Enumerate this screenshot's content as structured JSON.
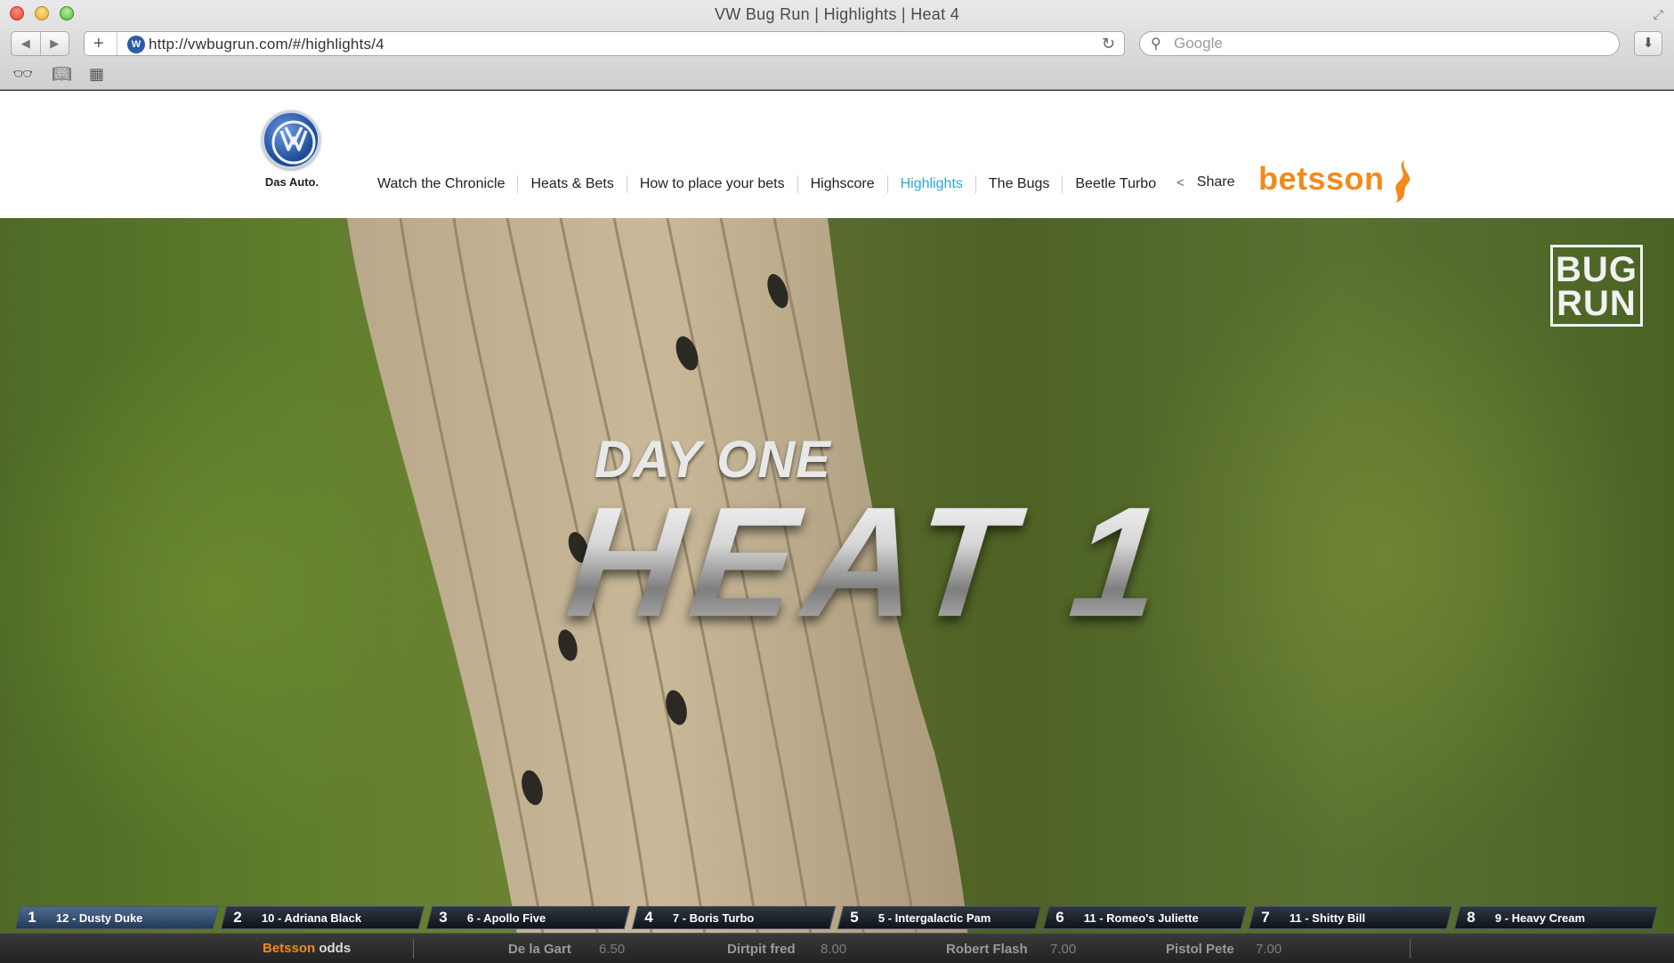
{
  "browser": {
    "window_title": "VW Bug Run | Highlights | Heat 4",
    "url": "http://vwbugrun.com/#/highlights/4",
    "search_placeholder": "Google",
    "url_badge": "W"
  },
  "site": {
    "brand_tagline": "Das Auto.",
    "nav": [
      {
        "label": "Watch the Chronicle",
        "active": false
      },
      {
        "label": "Heats & Bets",
        "active": false
      },
      {
        "label": "How to place your bets",
        "active": false
      },
      {
        "label": "Highscore",
        "active": false
      },
      {
        "label": "Highlights",
        "active": true
      },
      {
        "label": "The Bugs",
        "active": false
      },
      {
        "label": "Beetle Turbo",
        "active": false
      }
    ],
    "share_label": "Share",
    "sponsor": "betsson",
    "accent_color": "#2aa6e0",
    "sponsor_color": "#f28a1c"
  },
  "video": {
    "logo_top": "BUG",
    "logo_bottom": "RUN",
    "overlay_line1": "DAY ONE",
    "overlay_line2": "HEAT 1"
  },
  "lanes": [
    {
      "num": "1",
      "label": "12 - Dusty Duke"
    },
    {
      "num": "2",
      "label": "10 - Adriana Black"
    },
    {
      "num": "3",
      "label": "6 - Apollo Five"
    },
    {
      "num": "4",
      "label": "7 - Boris Turbo"
    },
    {
      "num": "5",
      "label": "5 - Intergalactic Pam"
    },
    {
      "num": "6",
      "label": "11 - Romeo's Juliette"
    },
    {
      "num": "7",
      "label": "11 - Shitty Bill"
    },
    {
      "num": "8",
      "label": "9 - Heavy Cream"
    }
  ],
  "odds": {
    "brand": "Betsson",
    "word": "odds",
    "entries": [
      {
        "name": "De la Gart",
        "value": "6.50"
      },
      {
        "name": "Dirtpit fred",
        "value": "8.00"
      },
      {
        "name": "Robert Flash",
        "value": "7.00"
      },
      {
        "name": "Pistol Pete",
        "value": "7.00"
      }
    ]
  }
}
